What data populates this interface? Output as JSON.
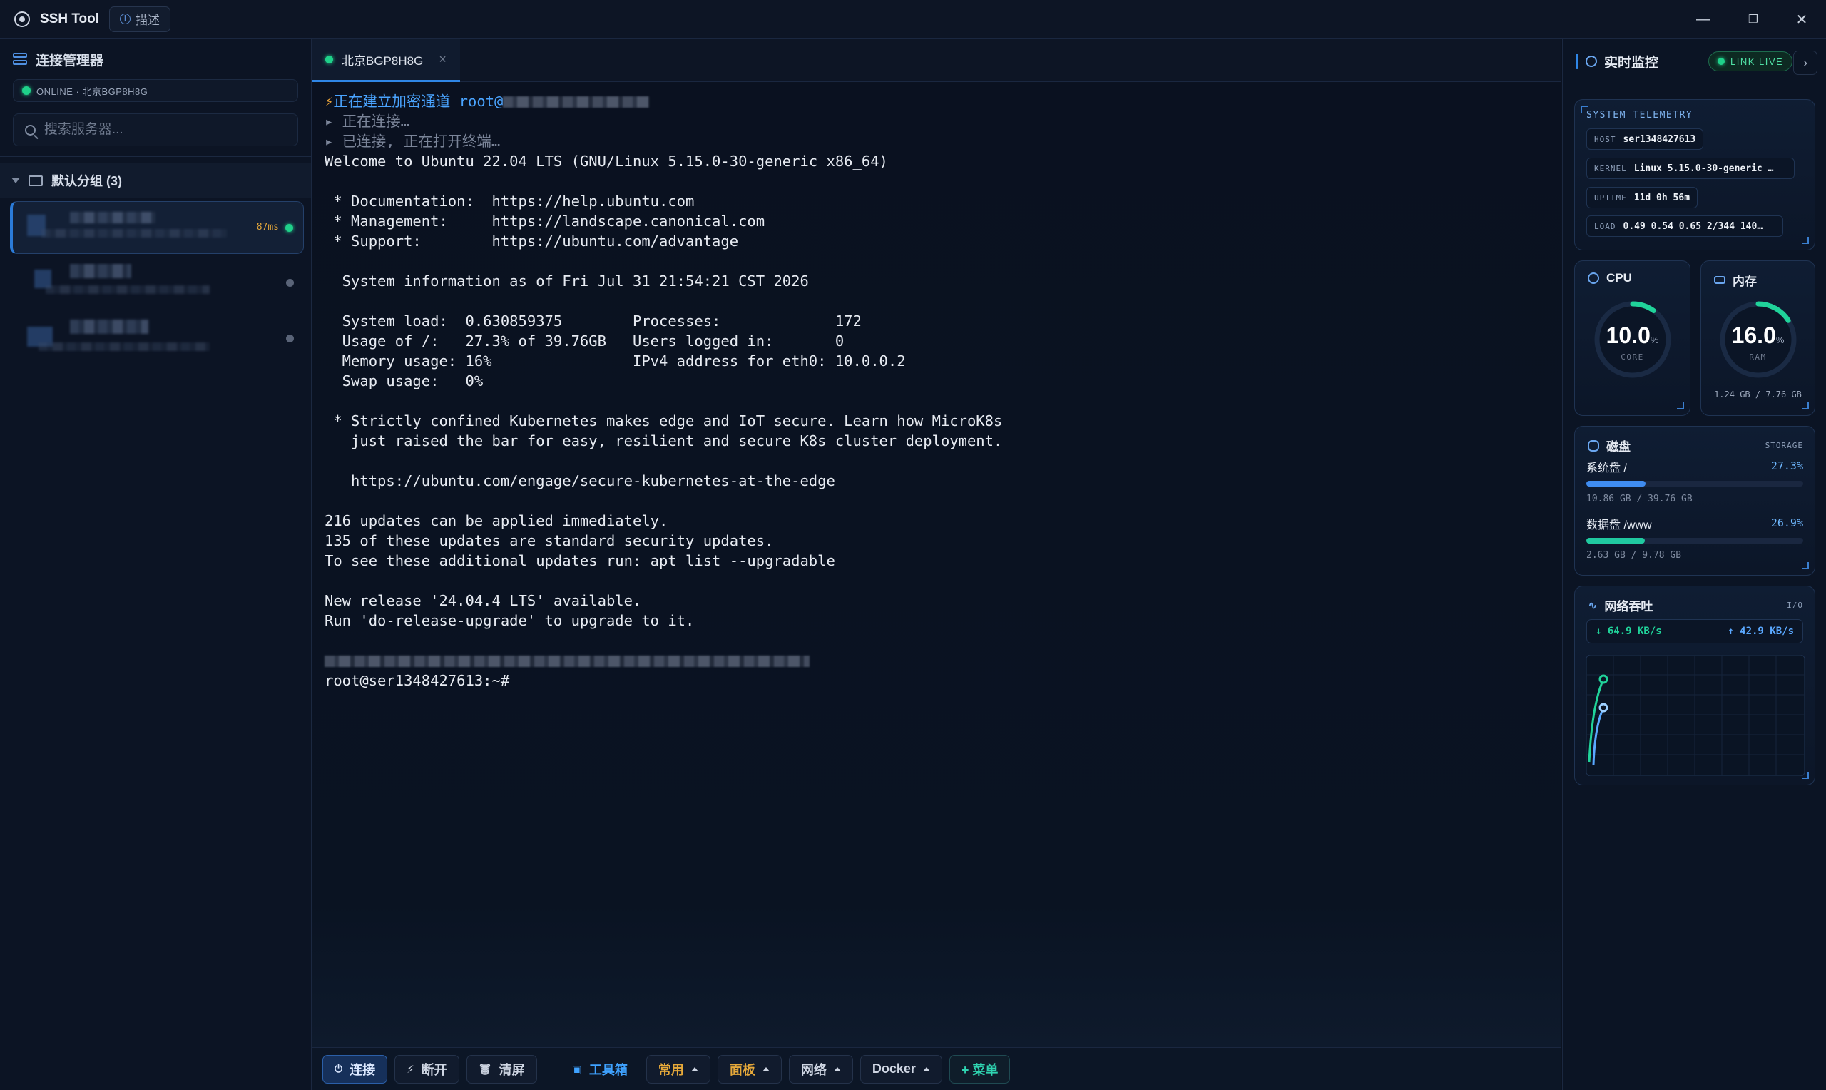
{
  "app": {
    "title": "SSH Tool",
    "desc_label": "描述"
  },
  "window_controls": {
    "minimize": "—",
    "restore": "❐",
    "close": "✕"
  },
  "sidebar": {
    "title": "连接管理器",
    "status": "ONLINE · 北京BGP8H8G",
    "search_placeholder": "搜索服务器...",
    "group": {
      "label": "默认分组 (3)"
    },
    "servers": [
      {
        "latency": "87ms",
        "online": true
      },
      {
        "latency": "",
        "online": false
      },
      {
        "latency": "",
        "online": false
      }
    ]
  },
  "tabs": [
    {
      "label": "北京BGP8H8G",
      "close": "×"
    }
  ],
  "terminal": {
    "connecting": "正在建立加密通道 root@",
    "lines_dim": [
      "▸ 正在连接…",
      "▸ 已连接, 正在打开终端…"
    ],
    "lines": [
      "Welcome to Ubuntu 22.04 LTS (GNU/Linux 5.15.0-30-generic x86_64)",
      "",
      " * Documentation:  https://help.ubuntu.com",
      " * Management:     https://landscape.canonical.com",
      " * Support:        https://ubuntu.com/advantage",
      "",
      "  System information as of Fri Jul 31 21:54:21 CST 2026",
      "",
      "  System load:  0.630859375        Processes:             172",
      "  Usage of /:   27.3% of 39.76GB   Users logged in:       0",
      "  Memory usage: 16%                IPv4 address for eth0: 10.0.0.2",
      "  Swap usage:   0%",
      "",
      " * Strictly confined Kubernetes makes edge and IoT secure. Learn how MicroK8s",
      "   just raised the bar for easy, resilient and secure K8s cluster deployment.",
      "",
      "   https://ubuntu.com/engage/secure-kubernetes-at-the-edge",
      "",
      "216 updates can be applied immediately.",
      "135 of these updates are standard security updates.",
      "To see these additional updates run: apt list --upgradable",
      "",
      "New release '24.04.4 LTS' available.",
      "Run 'do-release-upgrade' to upgrade to it.",
      ""
    ],
    "prompt": "root@ser1348427613:~#"
  },
  "toolbar": {
    "connect": "连接",
    "disconnect": "断开",
    "clear": "清屏",
    "toolbox": "工具箱",
    "common": "常用",
    "panel": "面板",
    "network": "网络",
    "docker": "Docker",
    "menu": "+ 菜单"
  },
  "monitor": {
    "title": "实时监控",
    "live": "LINK LIVE",
    "telemetry": {
      "title": "SYSTEM TELEMETRY",
      "rows": [
        {
          "key": "HOST",
          "value": "ser1348427613"
        },
        {
          "key": "KERNEL",
          "value": "Linux 5.15.0-30-generic …"
        },
        {
          "key": "UPTIME",
          "value": "11d 0h 56m"
        },
        {
          "key": "LOAD",
          "value": "0.49 0.54 0.65 2/344 140…"
        }
      ]
    },
    "cpu": {
      "label": "CPU",
      "value": "10.0",
      "unit": "%",
      "sub": "CORE",
      "percent": 10.0
    },
    "mem": {
      "label": "内存",
      "value": "16.0",
      "unit": "%",
      "sub": "RAM",
      "foot": "1.24 GB / 7.76 GB",
      "percent": 16.0
    },
    "disk": {
      "label": "磁盘",
      "tag": "STORAGE",
      "items": [
        {
          "name": "系统盘 /",
          "pct": "27.3%",
          "fraction": 0.273,
          "detail": "10.86 GB / 39.76 GB",
          "color": "#3f8cf0"
        },
        {
          "name": "数据盘 /www",
          "pct": "26.9%",
          "fraction": 0.269,
          "detail": "2.63 GB / 9.78 GB",
          "color": "#20c9a0"
        }
      ]
    },
    "network": {
      "label": "网络吞吐",
      "tag": "I/O",
      "down": "↓ 64.9 KB/s",
      "up": "↑ 42.9 KB/s"
    }
  },
  "colors": {
    "accent": "#2f86e6",
    "online": "#1fd18a",
    "warning": "#e0a43a"
  }
}
